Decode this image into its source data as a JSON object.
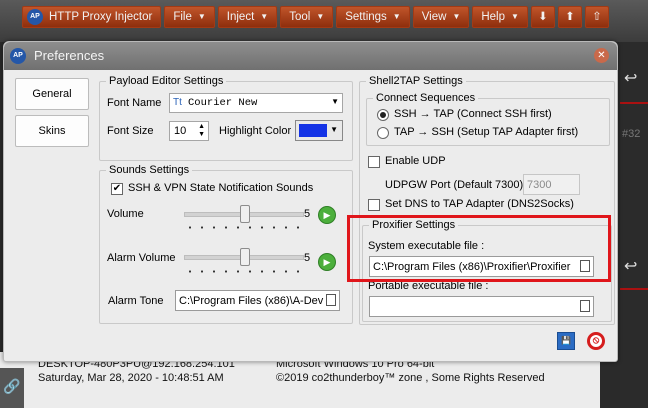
{
  "app": {
    "name": "HTTP Proxy Injector",
    "menu": [
      "File",
      "Inject",
      "Tool",
      "Settings",
      "View",
      "Help"
    ],
    "side_number": "#32",
    "status": {
      "host": "DESKTOP-480P3PU@192.168.254.101",
      "os": "Microsoft Windows 10 Pro 64-bit",
      "datetime": "Saturday, Mar 28, 2020 - 10:48:51 AM",
      "copyright": "©2019 co2thunderboy™ zone , Some Rights Reserved"
    }
  },
  "dialog": {
    "title": "Preferences",
    "nav": [
      "General",
      "Skins"
    ],
    "payload": {
      "title": "Payload Editor Settings",
      "font_name_label": "Font Name",
      "font_name_value": "Courier New",
      "font_size_label": "Font Size",
      "font_size_value": "10",
      "highlight_label": "Highlight Color",
      "highlight_color": "#1433e6"
    },
    "sounds": {
      "title": "Sounds Settings",
      "notify_label": "SSH & VPN State Notification Sounds",
      "notify_checked": true,
      "volume_label": "Volume",
      "volume_value": "5",
      "alarm_volume_label": "Alarm Volume",
      "alarm_volume_value": "5",
      "alarm_tone_label": "Alarm Tone",
      "alarm_tone_value": "C:\\Program Files (x86)\\A-Dev"
    },
    "shell2tap": {
      "title": "Shell2TAP Settings",
      "connect_title": "Connect Sequences",
      "opt1": "SSH → TAP (Connect SSH first)",
      "opt2": "TAP → SSH (Setup TAP Adapter first)",
      "enable_udp": "Enable UDP",
      "udpgw_label": "UDPGW Port (Default 7300)",
      "udpgw_value": "7300",
      "dns_label": "Set DNS to TAP Adapter (DNS2Socks)"
    },
    "proxifier": {
      "title": "Proxifier Settings",
      "system_label": "System executable file :",
      "system_value": "C:\\Program Files (x86)\\Proxifier\\Proxifier",
      "portable_label": "Portable executable file :",
      "portable_value": ""
    }
  }
}
